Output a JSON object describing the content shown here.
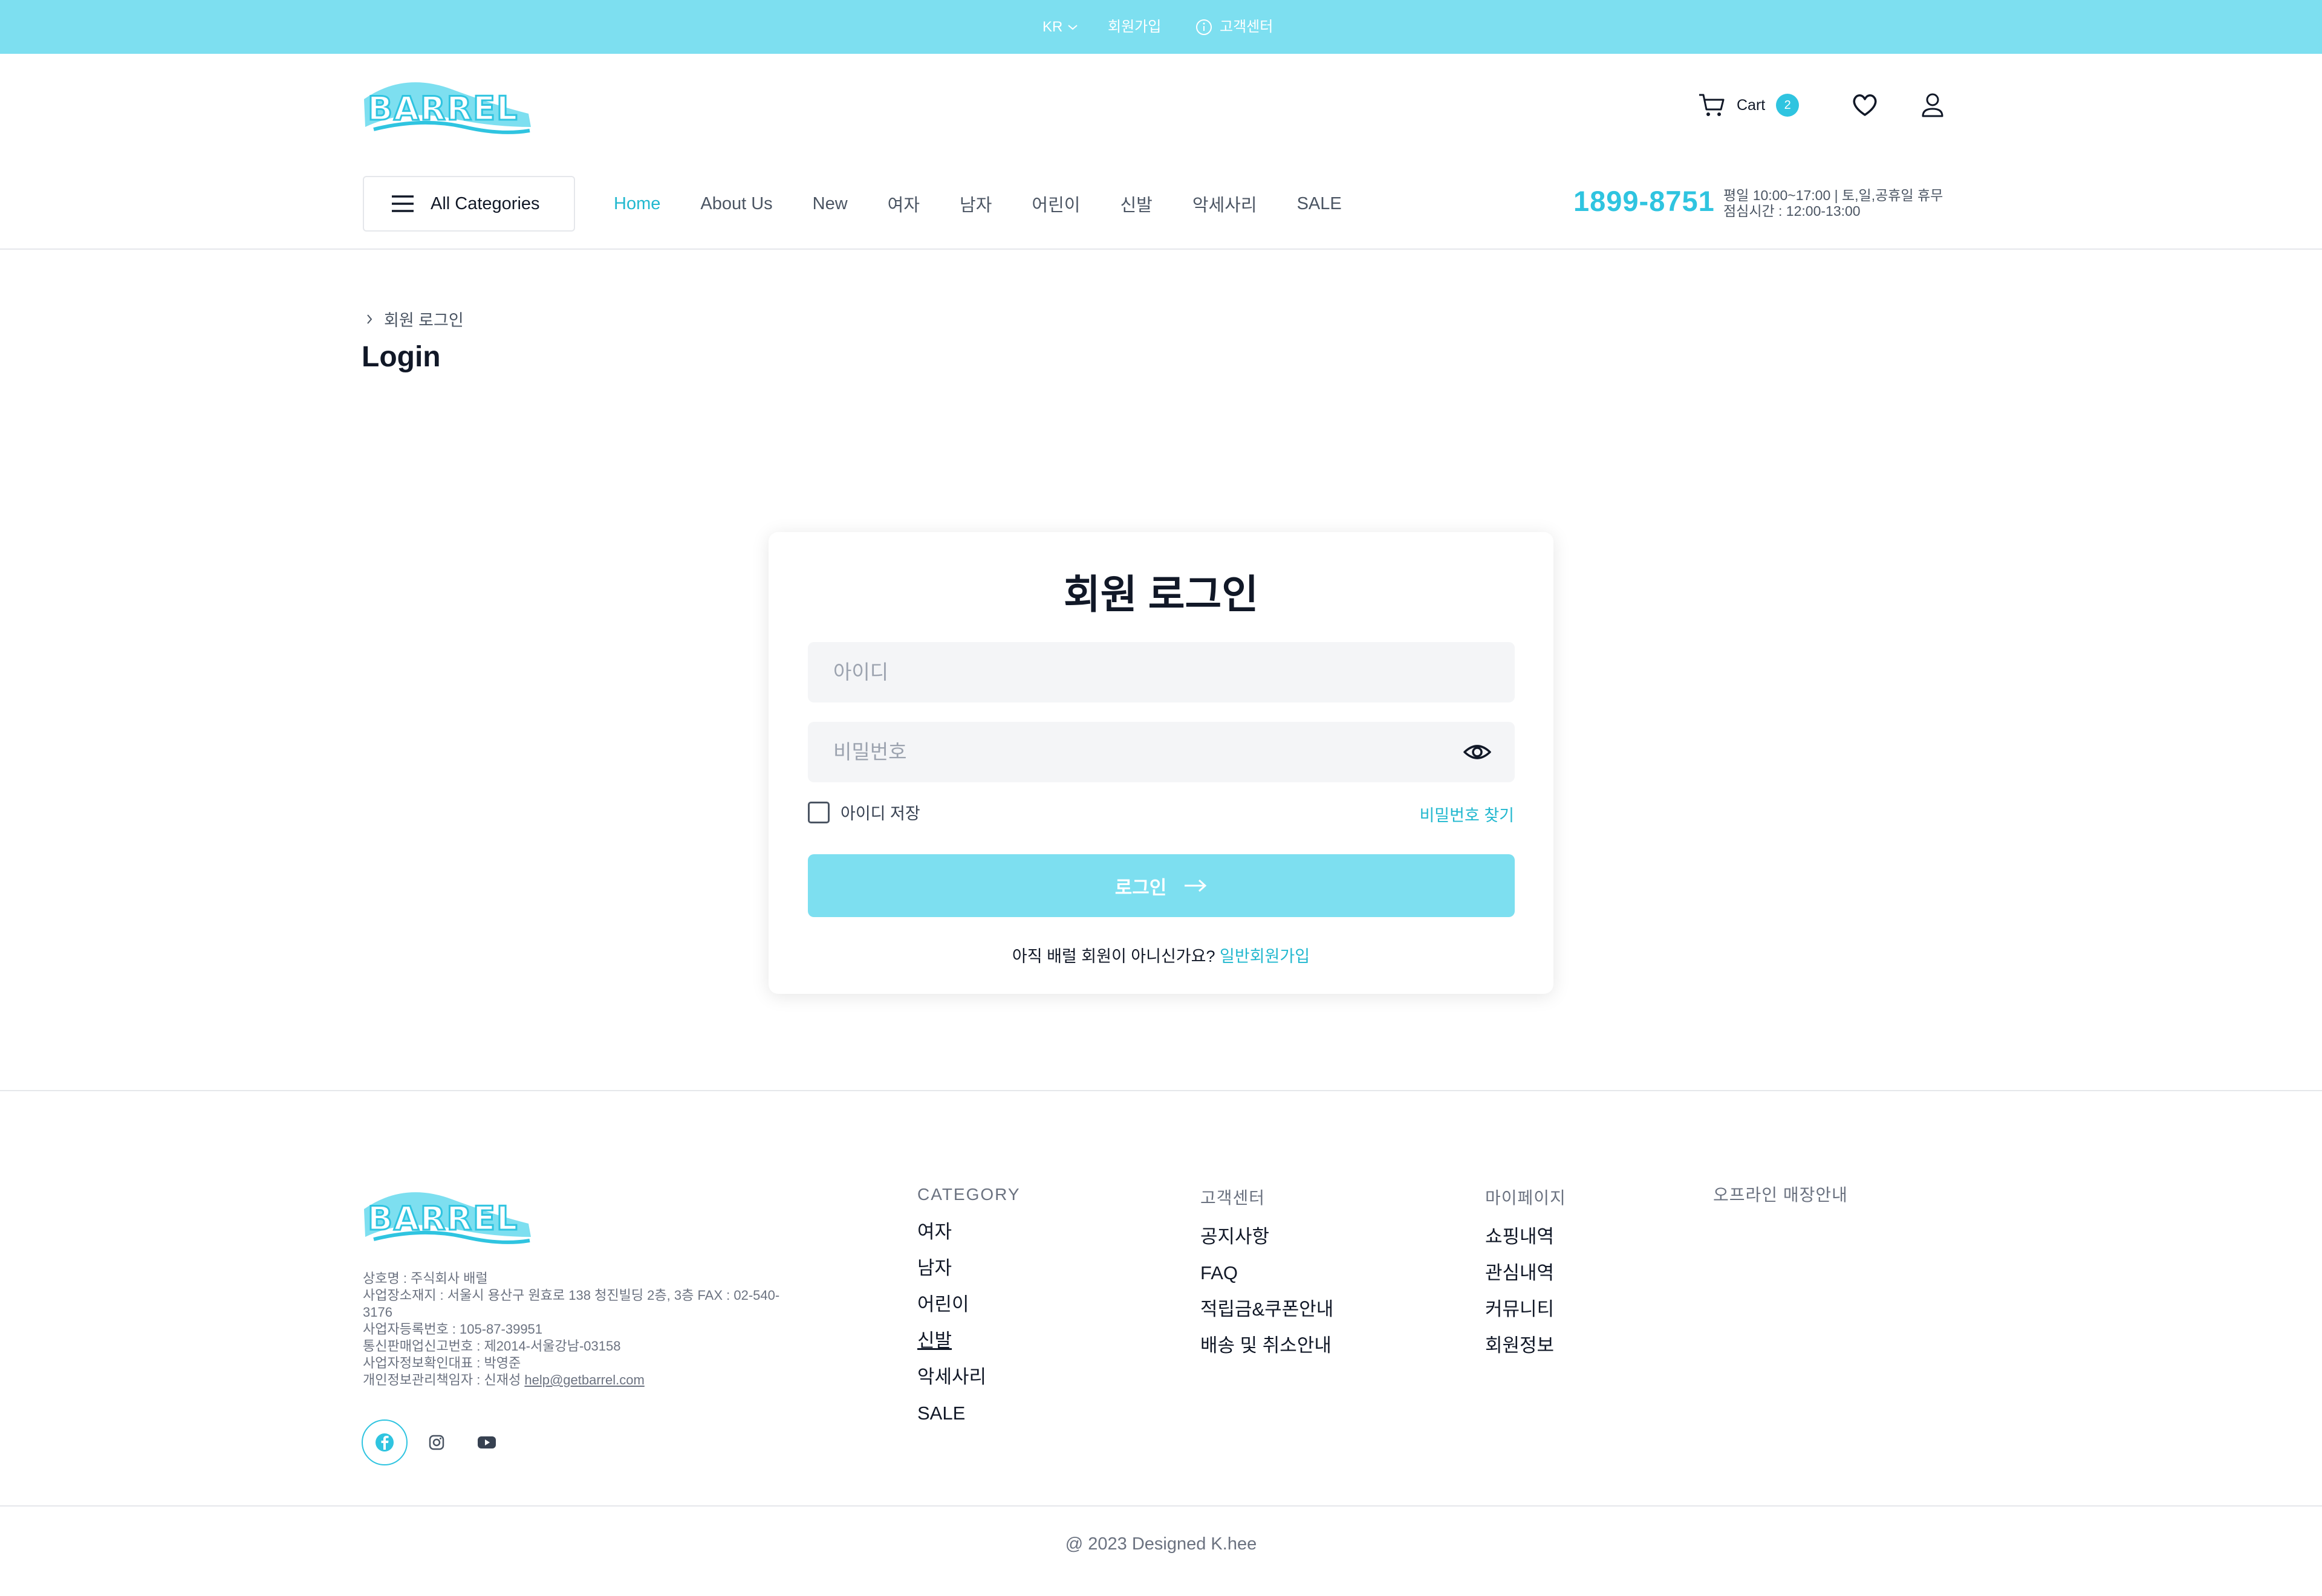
{
  "colors": {
    "accent": "#2fc4e0",
    "topbar": "#7ddff0",
    "link": "#22b8cf"
  },
  "topbar": {
    "language": "KR",
    "join": "회원가입",
    "customer_center": "고객센터"
  },
  "brand": {
    "logo_text": "BARREL"
  },
  "header": {
    "cart_label": "Cart",
    "cart_count": "2"
  },
  "nav": {
    "all_categories": "All Categories",
    "links": [
      "Home",
      "About Us",
      "New",
      "여자",
      "남자",
      "어린이",
      "신발",
      "악세사리",
      "SALE"
    ],
    "active": "Home",
    "phone": "1899-8751",
    "hours_line1": "평일 10:00~17:00 | 토,일,공휴일 휴무",
    "hours_line2": "점심시간 : 12:00-13:00"
  },
  "page": {
    "breadcrumb": "회원 로그인",
    "title": "Login"
  },
  "login": {
    "title": "회원 로그인",
    "id_placeholder": "아이디",
    "pw_placeholder": "비밀번호",
    "remember_label": "아이디 저장",
    "find_password": "비밀번호 찾기",
    "submit": "로그인",
    "signup_prompt": "아직 배럴 회원이 아니신가요?",
    "signup_link": "일반회원가입"
  },
  "footer": {
    "company": [
      "상호명 : 주식회사 배럴",
      "사업장소재지 : 서울시 용산구 원효로 138 청진빌딩 2층, 3층 FAX : 02-540-3176",
      "사업자등록번호 : 105-87-39951",
      "통신판매업신고번호 : 제2014-서울강남-03158",
      "사업자정보확인대표 : 박영준",
      "개인정보관리책임자 : 신재성"
    ],
    "email": "help@getbarrel.com",
    "category": {
      "title": "CATEGORY",
      "items": [
        "여자",
        "남자",
        "어린이",
        "신발",
        "악세사리",
        "SALE"
      ]
    },
    "cs": {
      "title": "고객센터",
      "items": [
        "공지사항",
        "FAQ",
        "적립금&쿠폰안내",
        "배송 및 취소안내"
      ]
    },
    "mypage": {
      "title": "마이페이지",
      "items": [
        "쇼핑내역",
        "관심내역",
        "커뮤니티",
        "회원정보"
      ]
    },
    "offline": {
      "title": "오프라인 매장안내"
    },
    "social_icons": [
      "facebook-icon",
      "instagram-icon",
      "youtube-icon"
    ],
    "copyright": "@ 2023 Designed K.hee"
  }
}
